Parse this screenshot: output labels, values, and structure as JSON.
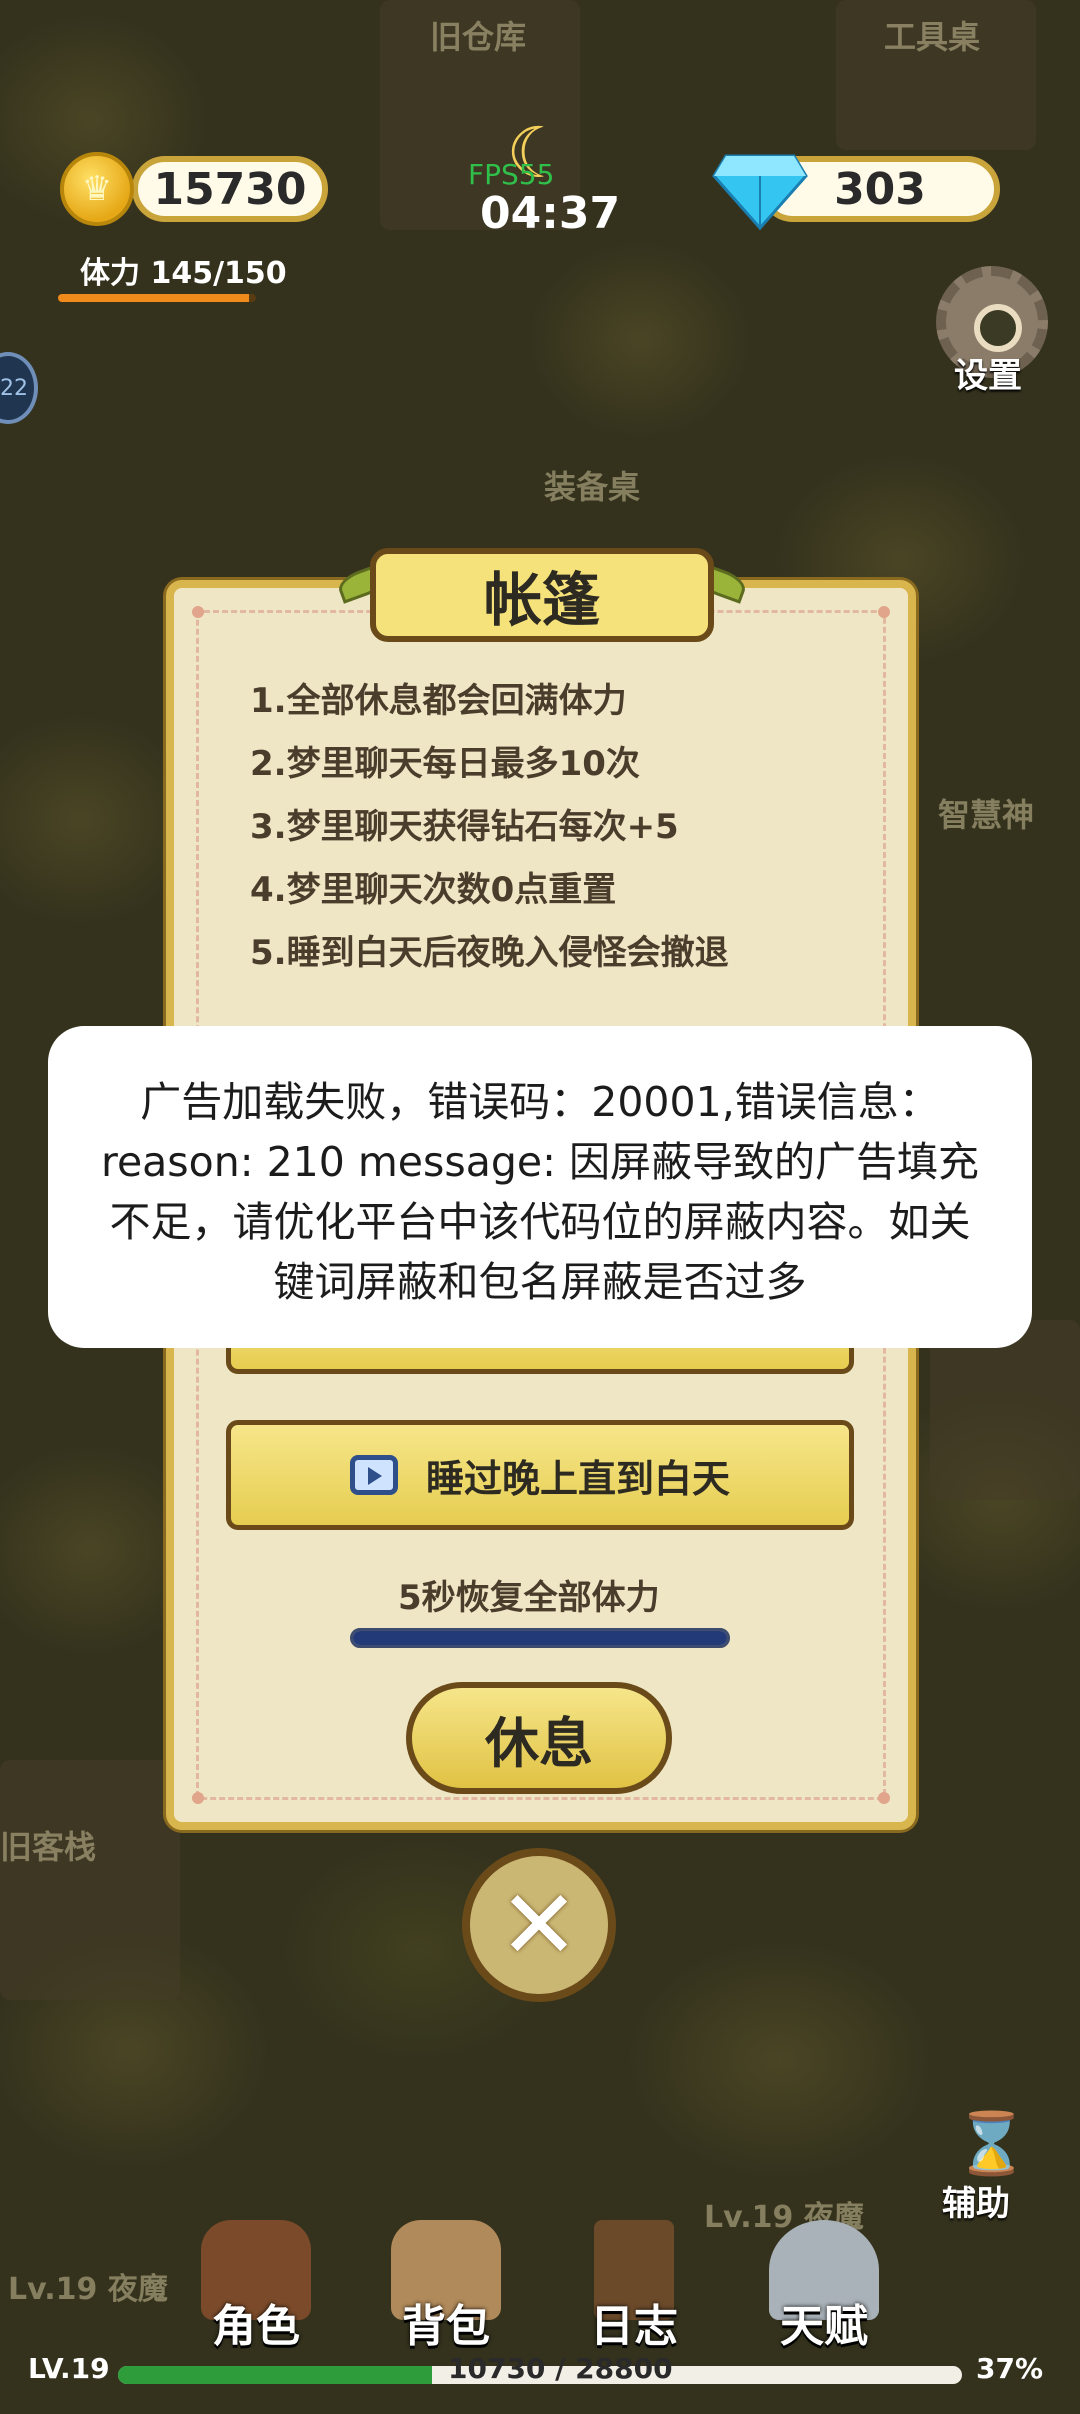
{
  "hud": {
    "coins": "15730",
    "gems": "303",
    "stamina": "体力 145/150",
    "stamina_fraction": 0.9667,
    "fps": "FPS55",
    "clock": "04:37",
    "settings_label": "设置"
  },
  "scene_labels": {
    "old_warehouse": "旧仓库",
    "workbench": "工具桌",
    "equipment_table": "装备桌",
    "wisdom_god": "智慧神",
    "old_inn": "旧客栈",
    "enemy_label_right": "Lv.19 夜魔",
    "enemy_label_left": "Lv.19 夜魔",
    "side_badge": "22"
  },
  "dialog": {
    "title": "帐篷",
    "rules": [
      "1.全部休息都会回满体力",
      "2.梦里聊天每日最多10次",
      "3.梦里聊天获得钻石每次+5",
      "4.梦里聊天次数0点重置",
      "5.睡到白天后夜晚入侵怪会撤退"
    ],
    "sleep_button": "睡过晚上直到白天",
    "recover_text": "5秒恢复全部体力",
    "recover_fraction": 1.0,
    "rest_button": "休息",
    "close_symbol": "✕"
  },
  "toast": {
    "message": "广告加载失败，错误码：20001,错误信息：reason: 210  message: 因屏蔽导致的广告填充不足，请优化平台中该代码位的屏蔽内容。如关键词屏蔽和包名屏蔽是否过多"
  },
  "bottom_nav": {
    "items": [
      {
        "label": "角色",
        "icon": "character-icon"
      },
      {
        "label": "背包",
        "icon": "backpack-icon"
      },
      {
        "label": "日志",
        "icon": "journal-icon"
      },
      {
        "label": "天赋",
        "icon": "talent-icon"
      }
    ],
    "help_label": "辅助"
  },
  "level_bar": {
    "level": "LV.19",
    "xp": "10730 / 28800",
    "percent": "37%",
    "fraction": 0.3726
  },
  "colors": {
    "accent_gold": "#e6cd50",
    "panel_bg": "#efe6c5",
    "xp_green": "#2f9c3c",
    "stamina_orange": "#f08a1a",
    "recover_blue": "#223a78"
  }
}
